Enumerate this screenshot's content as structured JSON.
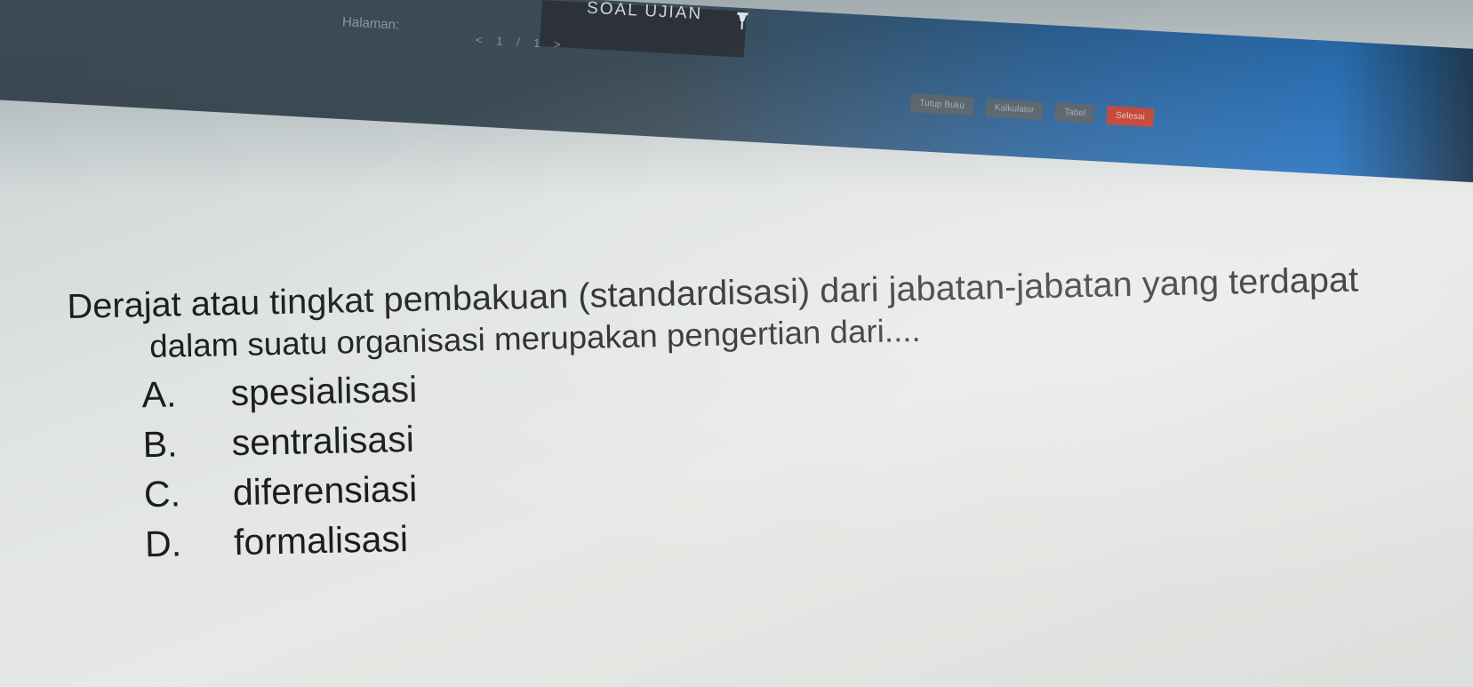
{
  "app": {
    "title": "SOAL UJIAN",
    "page_label": "Halaman:",
    "pager": "< 1 / 1 >"
  },
  "toolbar": {
    "buttons": [
      "Tutup Buku",
      "Kalkulator",
      "Tabel",
      "Selesai"
    ]
  },
  "question": {
    "line1": "Derajat atau tingkat pembakuan (standardisasi) dari jabatan-jabatan yang terdapat",
    "line2": "dalam suatu organisasi merupakan pengertian dari....",
    "options": [
      {
        "letter": "A.",
        "text": "spesialisasi"
      },
      {
        "letter": "B.",
        "text": "sentralisasi"
      },
      {
        "letter": "C.",
        "text": "diferensiasi"
      },
      {
        "letter": "D.",
        "text": "formalisasi"
      }
    ]
  },
  "colors": {
    "topbar": "#3c4a55",
    "accent_blue": "#1c6fc4",
    "accent_red": "#c0392b",
    "text": "#1b1d20"
  }
}
